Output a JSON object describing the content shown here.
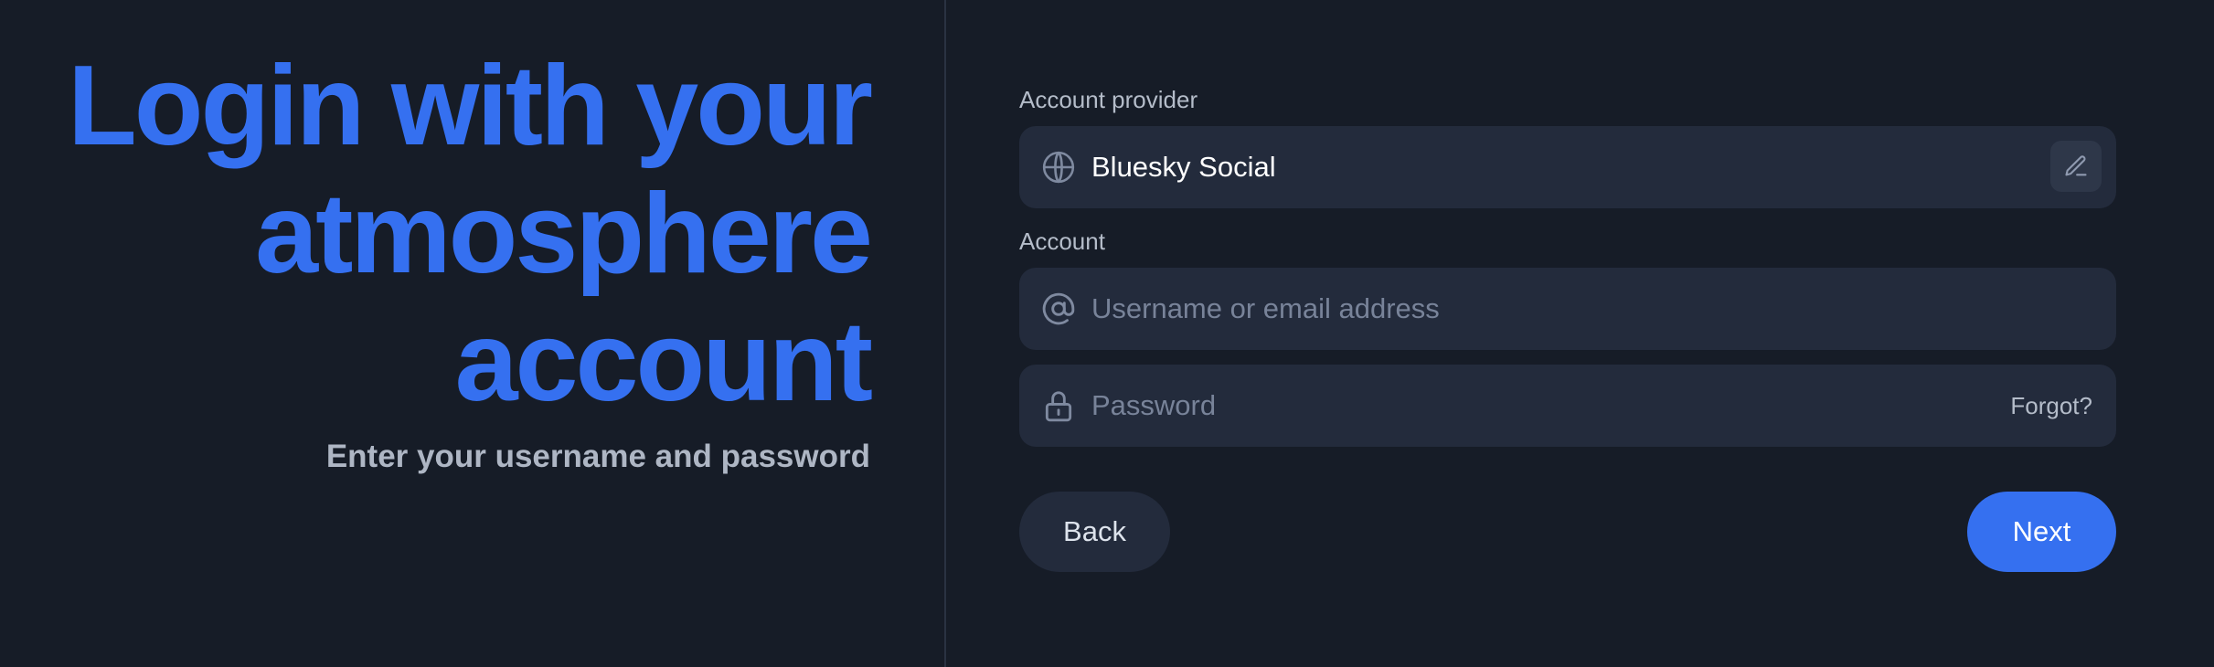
{
  "headline": {
    "line1": "Login with your",
    "line2": "atmosphere",
    "line3": "account"
  },
  "subtitle": "Enter your username and password",
  "provider": {
    "label": "Account provider",
    "value": "Bluesky Social",
    "icon": "globe-icon",
    "edit_icon": "pencil-icon"
  },
  "account": {
    "label": "Account",
    "username_placeholder": "Username or email address",
    "username_icon": "at-sign-icon",
    "password_placeholder": "Password",
    "password_icon": "lock-icon",
    "forgot_label": "Forgot?"
  },
  "actions": {
    "back_label": "Back",
    "next_label": "Next"
  },
  "colors": {
    "background": "#161c27",
    "accent": "#3570f0",
    "field_background": "#232b3c"
  }
}
